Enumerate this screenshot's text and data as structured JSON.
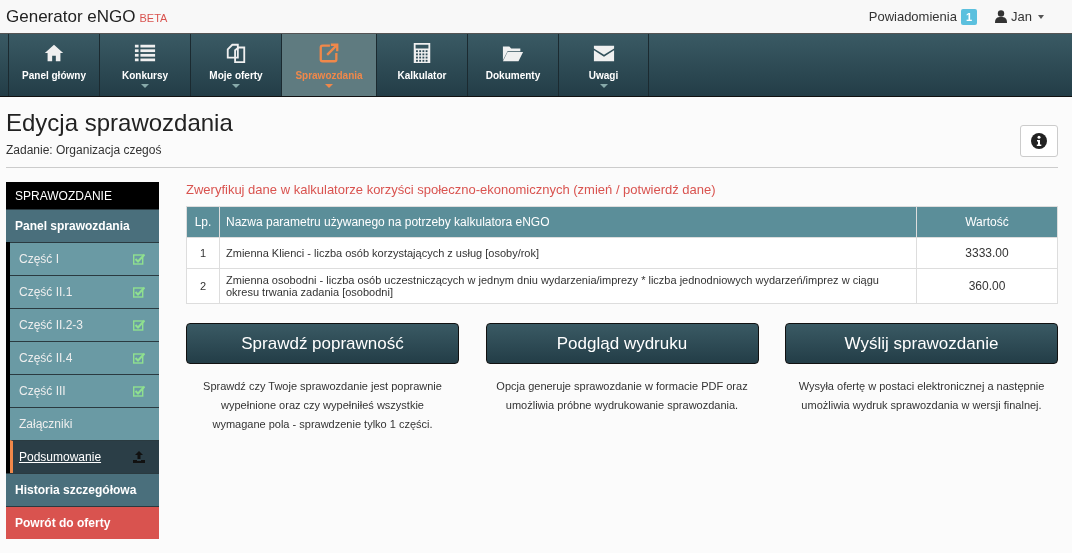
{
  "brand": {
    "name": "Generator eNGO",
    "badge": "BETA"
  },
  "top_bar": {
    "notifications": {
      "label": "Powiadomienia",
      "count": "1"
    },
    "user": {
      "name": "Jan"
    }
  },
  "nav": [
    {
      "label": "Panel główny",
      "dropdown": false,
      "selected": false
    },
    {
      "label": "Konkursy",
      "dropdown": true,
      "selected": false
    },
    {
      "label": "Moje oferty",
      "dropdown": true,
      "selected": false
    },
    {
      "label": "Sprawozdania",
      "dropdown": true,
      "selected": true
    },
    {
      "label": "Kalkulator",
      "dropdown": false,
      "selected": false
    },
    {
      "label": "Dokumenty",
      "dropdown": false,
      "selected": false
    },
    {
      "label": "Uwagi",
      "dropdown": true,
      "selected": false
    }
  ],
  "page": {
    "title": "Edycja sprawozdania",
    "subtitle": "Zadanie: Organizacja czegoś"
  },
  "sidebar": {
    "heading": "SPRAWOZDANIE",
    "items": [
      {
        "label": "Panel sprawozdania",
        "kind": "section",
        "selected": false,
        "children": [
          {
            "label": "Część I",
            "kind": "checked",
            "selected": false
          },
          {
            "label": "Część II.1",
            "kind": "checked",
            "selected": false
          },
          {
            "label": "Część II.2-3",
            "kind": "checked",
            "selected": false
          },
          {
            "label": "Część II.4",
            "kind": "checked",
            "selected": false
          },
          {
            "label": "Część III",
            "kind": "checked",
            "selected": false
          },
          {
            "label": "Załączniki",
            "kind": "plain",
            "selected": false
          },
          {
            "label": "Podsumowanie",
            "kind": "upload",
            "selected": true
          }
        ]
      },
      {
        "label": "Historia szczegółowa",
        "kind": "section",
        "selected": false
      },
      {
        "label": "Powrót do oferty",
        "kind": "danger",
        "selected": false
      }
    ]
  },
  "notice": "Zweryfikuj dane w kalkulatorze korzyści społeczno-ekonomicznych (zmień / potwierdź dane)",
  "table": {
    "columns": [
      "Lp.",
      "Nazwa parametru używanego na potrzeby kalkulatora eNGO",
      "Wartość"
    ],
    "rows": [
      [
        "1",
        "Zmienna Klienci - liczba osób korzystających z usług [osoby/rok]",
        "3333.00"
      ],
      [
        "2",
        "Zmienna osobodni - liczba osób uczestniczących w jednym dniu wydarzenia/imprezy * liczba jednodniowych wydarzeń/imprez w ciągu okresu trwania zadania [osobodni]",
        "360.00"
      ]
    ]
  },
  "actions": [
    {
      "label": "Sprawdź poprawność",
      "description": "Sprawdź czy Twoje sprawozdanie jest poprawnie wypełnione oraz czy wypełniłeś wszystkie wymagane pola - sprawdzenie tylko 1 części."
    },
    {
      "label": "Podgląd wydruku",
      "description": "Opcja generuje sprawozdanie w formacie PDF oraz umożliwia próbne wydrukowanie sprawozdania."
    },
    {
      "label": "Wyślij sprawozdanie",
      "description": "Wysyła ofertę w postaci elektronicznej a następnie umożliwia wydruk sprawozdania w wersji finalnej."
    }
  ]
}
